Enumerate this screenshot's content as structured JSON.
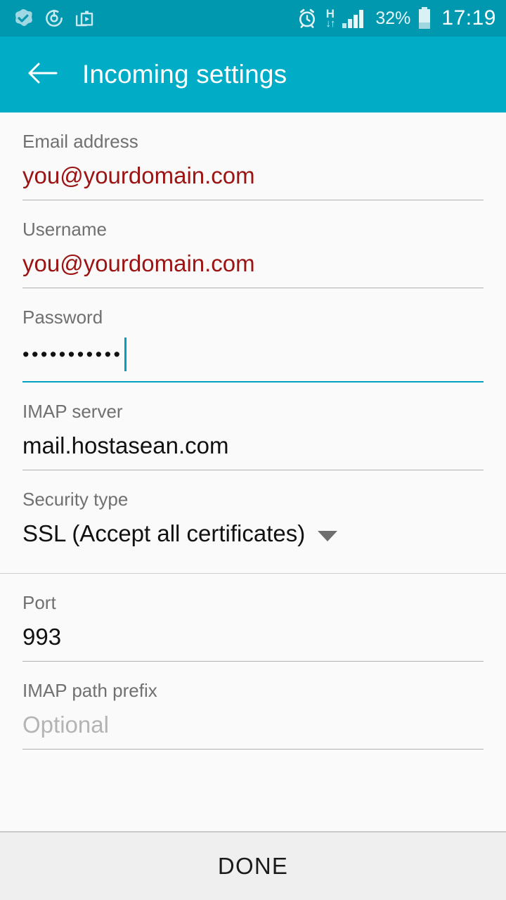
{
  "status_bar": {
    "icons_left": [
      "check-badge-icon",
      "power-restart-icon",
      "play-store-icon"
    ],
    "alarm_icon": "alarm-clock-icon",
    "network_type": "H",
    "network_arrows": "↓↑",
    "signal_icon": "signal-bars-icon",
    "battery_percent": "32%",
    "battery_icon": "battery-icon",
    "time": "17:19"
  },
  "app_bar": {
    "back_icon": "back-arrow-icon",
    "title": "Incoming settings",
    "background": "#00ACC6"
  },
  "theme": {
    "accent": "#00A0BE",
    "status_bar_bg": "#0098AE",
    "error_text": "#9C1313",
    "page_bg": "#FAFAFA"
  },
  "fields": [
    {
      "label": "Email address",
      "value": "you@yourdomain.com",
      "state": "error",
      "focused": false,
      "name": "email-address"
    },
    {
      "label": "Username",
      "value": "you@yourdomain.com",
      "state": "error",
      "focused": false,
      "name": "username"
    },
    {
      "label": "Password",
      "value": "•••••••••••",
      "state": "masked",
      "focused": true,
      "name": "password"
    },
    {
      "label": "IMAP server",
      "value": "mail.hostasean.com",
      "state": "normal",
      "focused": false,
      "name": "imap-server"
    },
    {
      "label": "Security type",
      "value": "SSL (Accept all certificates)",
      "state": "spinner",
      "focused": false,
      "name": "security-type"
    },
    {
      "label": "Port",
      "value": "993",
      "state": "normal",
      "focused": false,
      "name": "port"
    },
    {
      "label": "IMAP path prefix",
      "value": "Optional",
      "state": "placeholder",
      "focused": false,
      "name": "imap-path-prefix"
    }
  ],
  "bottom_bar": {
    "done_label": "DONE"
  }
}
